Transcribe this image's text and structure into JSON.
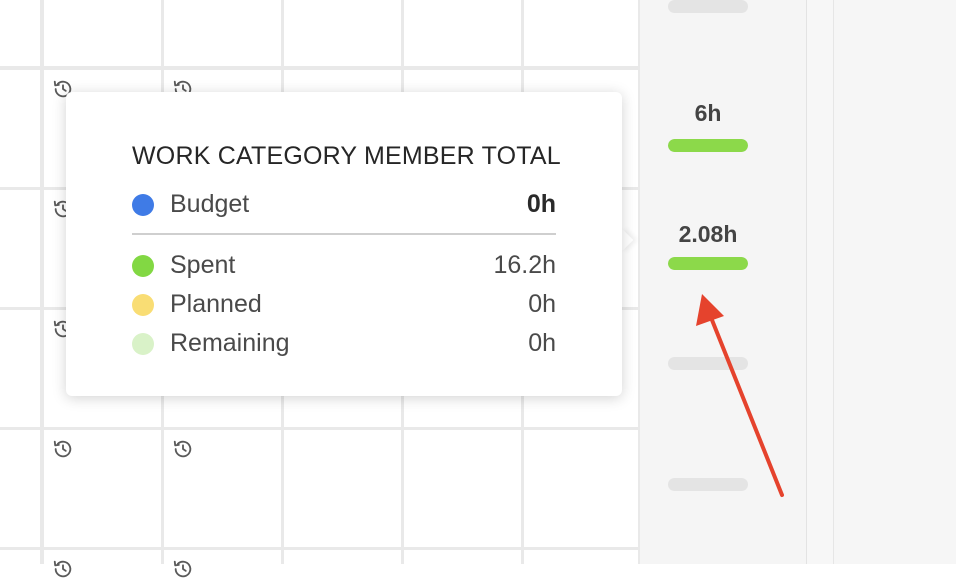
{
  "grid": {
    "history_icon": "history-icon"
  },
  "totals": [
    {
      "label": "",
      "spent_fraction": 0,
      "color": "#e4e4e4"
    },
    {
      "label": "6h",
      "spent_fraction": 1,
      "color": "#8cd94a"
    },
    {
      "label": "2.08h",
      "spent_fraction": 1,
      "color": "#8cd94a"
    },
    {
      "label": "",
      "spent_fraction": 0,
      "color": "#e4e4e4"
    },
    {
      "label": "",
      "spent_fraction": 0,
      "color": "#e4e4e4"
    }
  ],
  "tooltip": {
    "title": "WORK CATEGORY MEMBER TOTAL",
    "budget": {
      "label": "Budget",
      "value": "0h",
      "color": "#3f7be6"
    },
    "spent": {
      "label": "Spent",
      "value": "16.2h",
      "color": "#82d843"
    },
    "planned": {
      "label": "Planned",
      "value": "0h",
      "color": "#f9dd74"
    },
    "remaining": {
      "label": "Remaining",
      "value": "0h",
      "color": "#d9f2c8"
    }
  },
  "annotation": {
    "color": "#e5432d",
    "icon": "red-arrow"
  }
}
